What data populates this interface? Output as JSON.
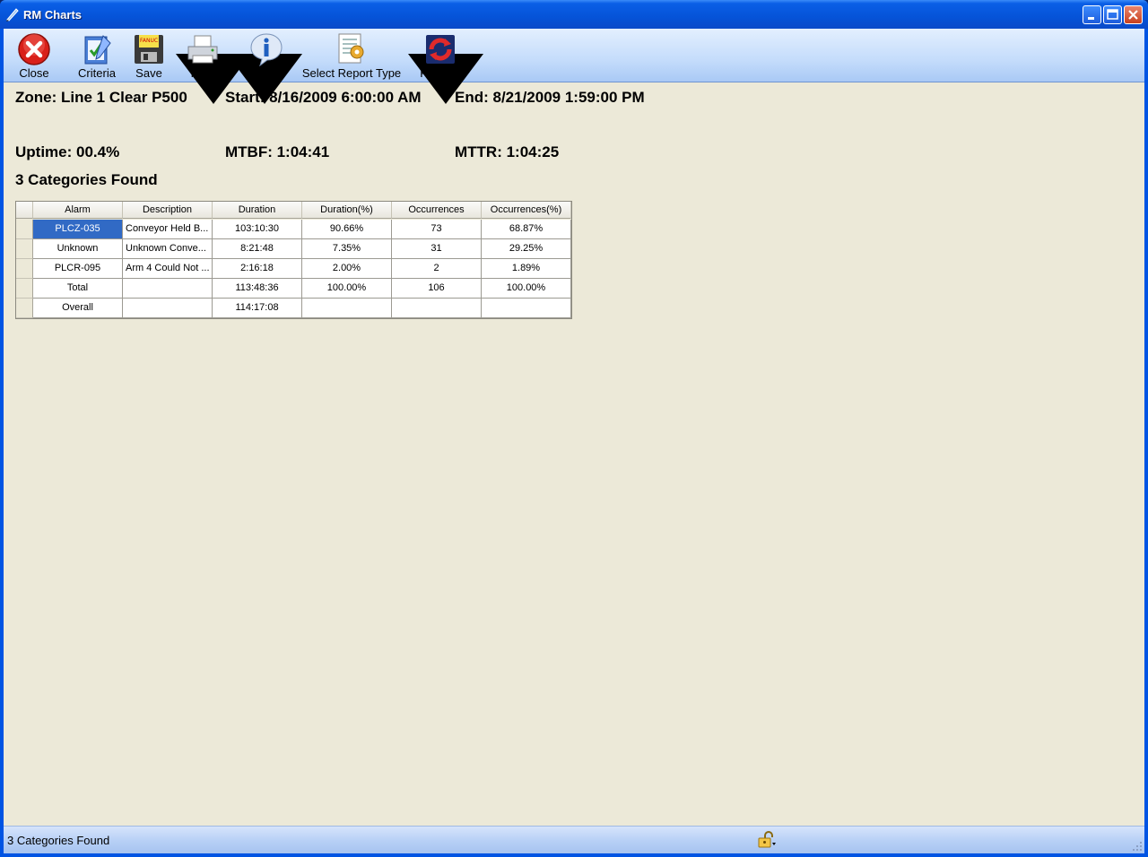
{
  "window": {
    "title": "RM Charts"
  },
  "toolbar": {
    "close": "Close",
    "criteria": "Criteria",
    "save": "Save",
    "print": "Print",
    "status": "Status",
    "select_report_type": "Select Report Type",
    "refresh": "Refresh"
  },
  "summary": {
    "zone": "Zone: Line 1 Clear P500",
    "start": "Start: 8/16/2009 6:00:00 AM",
    "end": "End: 8/21/2009 1:59:00 PM",
    "uptime": "Uptime: 00.4%",
    "mtbf": "MTBF: 1:04:41",
    "mttr": "MTTR: 1:04:25",
    "categories_found": "3 Categories Found"
  },
  "grid": {
    "columns": [
      "Alarm",
      "Description",
      "Duration",
      "Duration(%)",
      "Occurrences",
      "Occurrences(%)"
    ],
    "rows": [
      [
        "PLCZ-035",
        "Conveyor Held B...",
        "103:10:30",
        "90.66%",
        "73",
        "68.87%"
      ],
      [
        "Unknown",
        "Unknown Conve...",
        "8:21:48",
        "7.35%",
        "31",
        "29.25%"
      ],
      [
        "PLCR-095",
        "Arm 4 Could Not ...",
        "2:16:18",
        "2.00%",
        "2",
        "1.89%"
      ],
      [
        "Total",
        "",
        "113:48:36",
        "100.00%",
        "106",
        "100.00%"
      ],
      [
        "Overall",
        "",
        "114:17:08",
        "",
        "",
        ""
      ]
    ]
  },
  "statusbar": {
    "text": "3 Categories Found"
  },
  "colors": {
    "selection": "#316ac5",
    "titlebar": "#0553d8",
    "background": "#ece9d8"
  }
}
